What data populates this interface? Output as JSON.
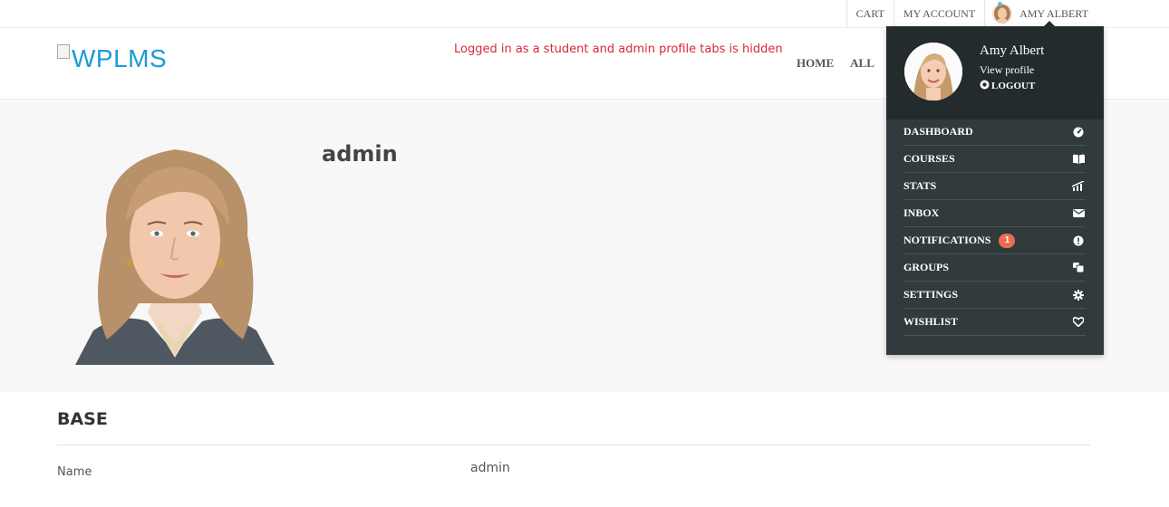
{
  "topbar": {
    "cart": "CART",
    "my_account": "MY ACCOUNT",
    "user_name": "AMY ALBERT"
  },
  "header": {
    "logo_text": "WPLMS",
    "notice": "Logged in as a student and admin profile tabs is hidden",
    "notice_color": "#d9263d",
    "nav": [
      "HOME",
      "ALL"
    ]
  },
  "profile": {
    "name": "admin"
  },
  "base": {
    "title": "BASE",
    "fields": [
      {
        "label": "Name",
        "value": "admin"
      }
    ]
  },
  "dropdown": {
    "name": "Amy Albert",
    "view_profile": "View profile",
    "logout": "LOGOUT",
    "items": [
      {
        "label": "DASHBOARD",
        "icon": "dashboard-icon"
      },
      {
        "label": "COURSES",
        "icon": "book-icon"
      },
      {
        "label": "STATS",
        "icon": "stats-icon"
      },
      {
        "label": "INBOX",
        "icon": "envelope-icon"
      },
      {
        "label": "NOTIFICATIONS",
        "icon": "alert-icon",
        "badge": "1"
      },
      {
        "label": "GROUPS",
        "icon": "groups-icon"
      },
      {
        "label": "SETTINGS",
        "icon": "gear-icon"
      },
      {
        "label": "WISHLIST",
        "icon": "heart-icon"
      }
    ],
    "badge_color": "#ec6b4e",
    "background": "#313b3d"
  }
}
